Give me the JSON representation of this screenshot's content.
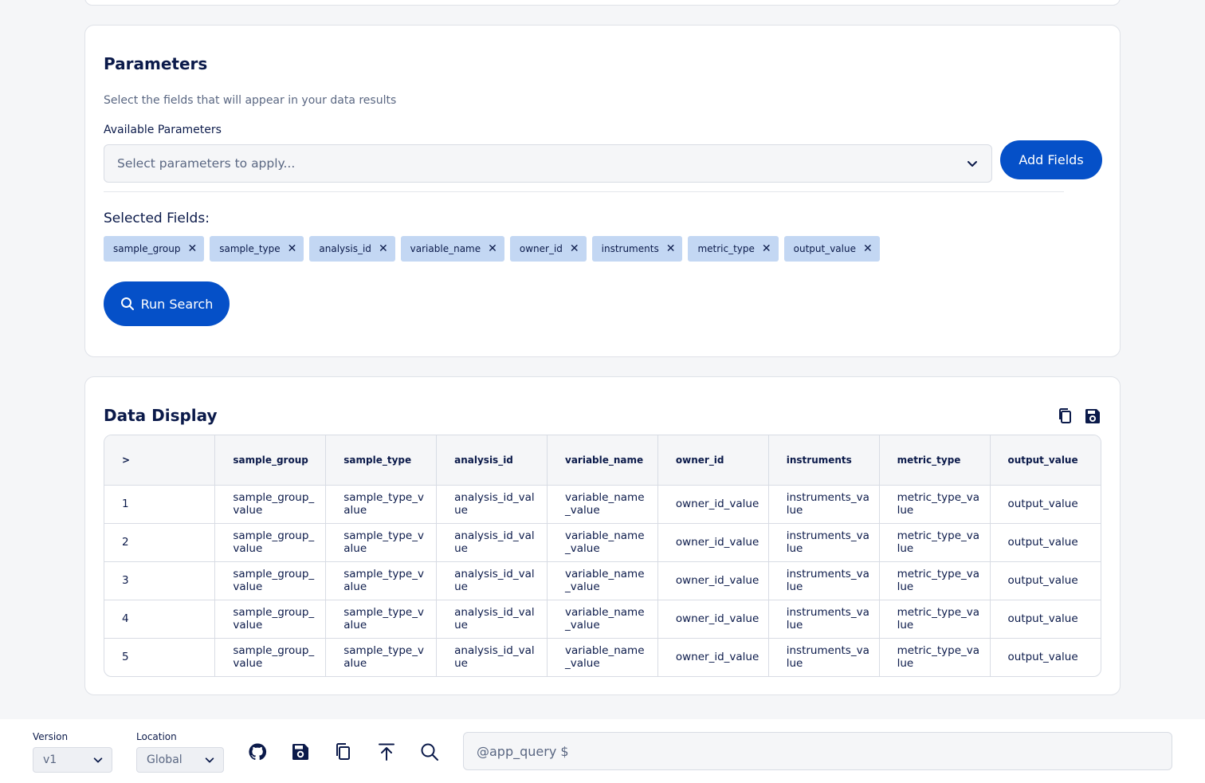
{
  "parameters": {
    "title": "Parameters",
    "subtitle": "Select the fields that will appear in your data results",
    "available_label": "Available Parameters",
    "select_placeholder": "Select parameters to apply...",
    "add_fields_label": "Add Fields",
    "selected_label": "Selected Fields:",
    "selected_fields": [
      "sample_group",
      "sample_type",
      "analysis_id",
      "variable_name",
      "owner_id",
      "instruments",
      "metric_type",
      "output_value"
    ],
    "run_search_label": "Run Search"
  },
  "data_display": {
    "title": "Data Display",
    "columns": [
      ">",
      "sample_group",
      "sample_type",
      "analysis_id",
      "variable_name",
      "owner_id",
      "instruments",
      "metric_type",
      "output_value"
    ],
    "rows": [
      [
        "1",
        "sample_group_value",
        "sample_type_value",
        "analysis_id_value",
        "variable_name_value",
        "owner_id_value",
        "instruments_value",
        "metric_type_value",
        "output_value"
      ],
      [
        "2",
        "sample_group_value",
        "sample_type_value",
        "analysis_id_value",
        "variable_name_value",
        "owner_id_value",
        "instruments_value",
        "metric_type_value",
        "output_value"
      ],
      [
        "3",
        "sample_group_value",
        "sample_type_value",
        "analysis_id_value",
        "variable_name_value",
        "owner_id_value",
        "instruments_value",
        "metric_type_value",
        "output_value"
      ],
      [
        "4",
        "sample_group_value",
        "sample_type_value",
        "analysis_id_value",
        "variable_name_value",
        "owner_id_value",
        "instruments_value",
        "metric_type_value",
        "output_value"
      ],
      [
        "5",
        "sample_group_value",
        "sample_type_value",
        "analysis_id_value",
        "variable_name_value",
        "owner_id_value",
        "instruments_value",
        "metric_type_value",
        "output_value"
      ]
    ]
  },
  "footer": {
    "version_label": "Version",
    "version_value": "v1",
    "location_label": "Location",
    "location_value": "Global",
    "query_placeholder": "@app_query $",
    "icons": [
      "github-icon",
      "save-icon",
      "copy-icon",
      "upload-icon",
      "search-icon"
    ]
  },
  "colors": {
    "primary": "#0550c8",
    "chip": "#c3d7f3",
    "text": "#0b1a4a"
  }
}
